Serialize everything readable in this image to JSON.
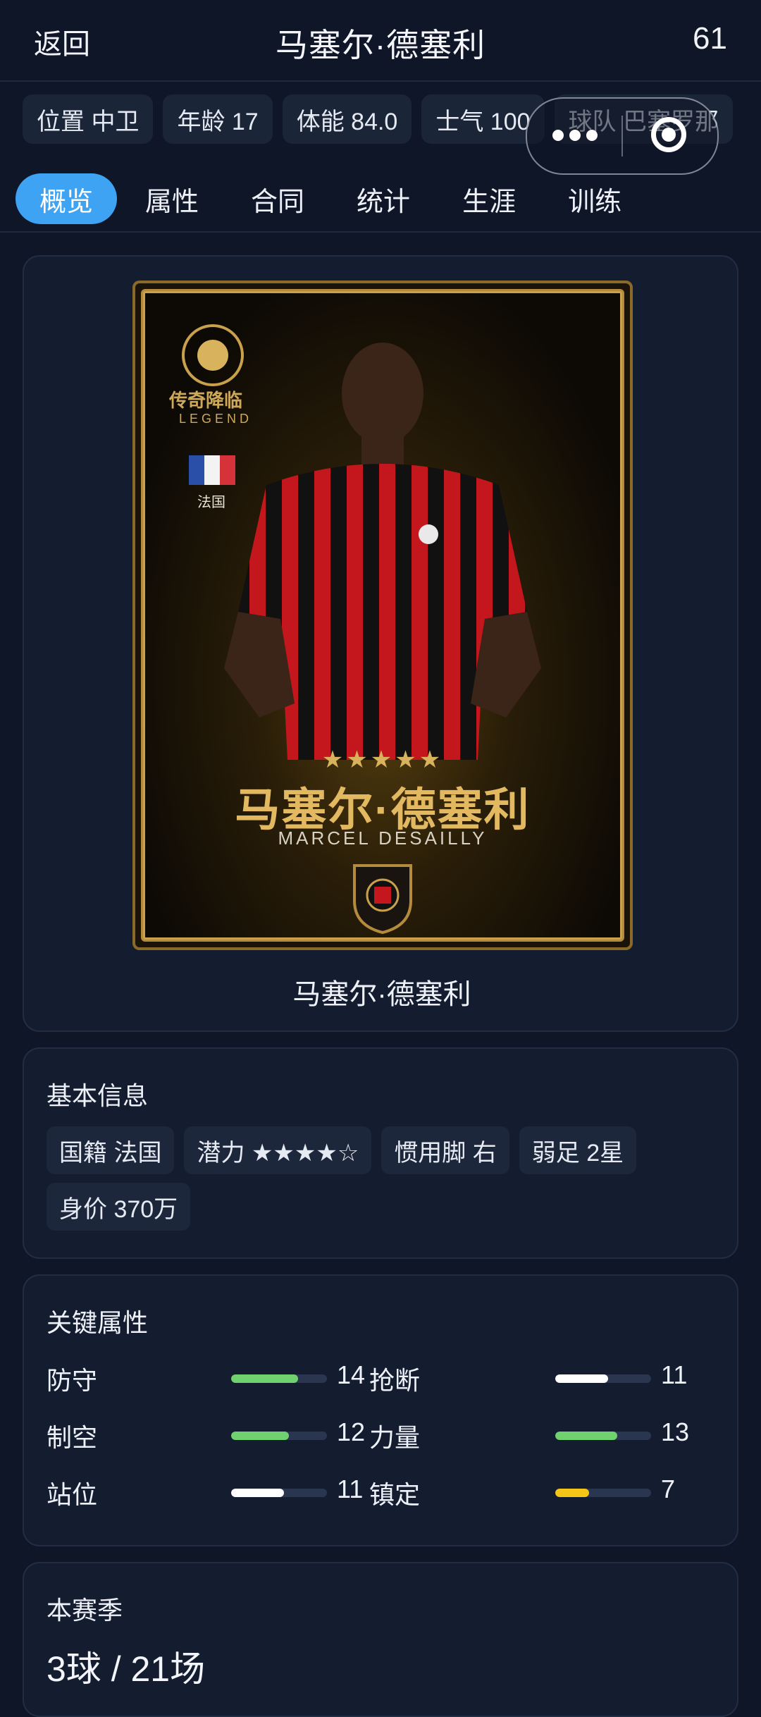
{
  "header": {
    "back_label": "返回",
    "title": "马塞尔·德塞利",
    "rating": "61"
  },
  "chips": [
    "位置 中卫",
    "年龄 17",
    "体能 84.0",
    "士气 100",
    "球队 巴塞罗那"
  ],
  "tabs": [
    "概览",
    "属性",
    "合同",
    "统计",
    "生涯",
    "训练"
  ],
  "card_art": {
    "legend_cn": "传奇降临",
    "legend_en": "LEGEND",
    "nation": "法国",
    "stars": "★★★★★",
    "name_cn": "马塞尔·德塞利",
    "name_en": "MARCEL DESAILLY"
  },
  "card_caption": "马塞尔·德塞利",
  "basic_info": {
    "title": "基本信息",
    "items": [
      "国籍 法国",
      "潜力 ★★★★☆",
      "惯用脚 右",
      "弱足 2星",
      "身价 370万"
    ]
  },
  "key_attrs": {
    "title": "关键属性",
    "rows": [
      {
        "left": {
          "label": "防守",
          "value": "14",
          "level": 0.7,
          "color": "#6fd26f"
        },
        "right": {
          "label": "抢断",
          "value": "11",
          "level": 0.55,
          "color": "#ffffff"
        }
      },
      {
        "left": {
          "label": "制空",
          "value": "12",
          "level": 0.6,
          "color": "#6fd26f"
        },
        "right": {
          "label": "力量",
          "value": "13",
          "level": 0.65,
          "color": "#6fd26f"
        }
      },
      {
        "left": {
          "label": "站位",
          "value": "11",
          "level": 0.55,
          "color": "#ffffff"
        },
        "right": {
          "label": "镇定",
          "value": "7",
          "level": 0.35,
          "color": "#f5c518"
        }
      }
    ]
  },
  "season": {
    "title": "本赛季",
    "score": "3球 / 21场"
  }
}
